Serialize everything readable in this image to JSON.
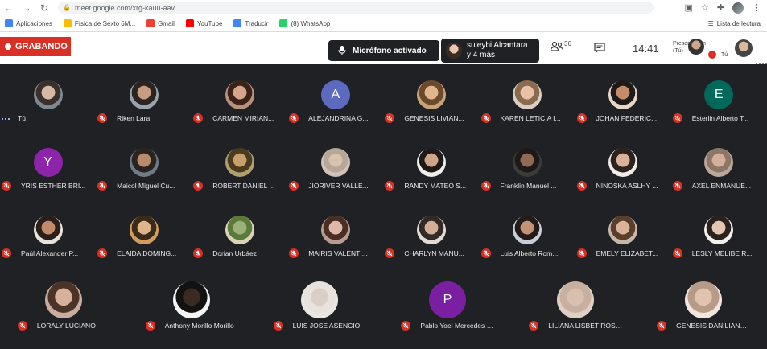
{
  "browser": {
    "url": "meet.google.com/xrg-kauu-aav",
    "bookmarks": [
      {
        "label": "Aplicaciones",
        "icon": "apps-grid-icon",
        "color": "#4285f4"
      },
      {
        "label": "Física de Sexto 6M...",
        "icon": "bookmark-page-icon",
        "color": "#fbbc04"
      },
      {
        "label": "Gmail",
        "icon": "gmail-icon",
        "color": "#ea4335"
      },
      {
        "label": "YouTube",
        "icon": "youtube-icon",
        "color": "#ff0000"
      },
      {
        "label": "Traducir",
        "icon": "translate-icon",
        "color": "#4285f4"
      },
      {
        "label": "(8) WhatsApp",
        "icon": "whatsapp-icon",
        "color": "#25d366"
      }
    ],
    "reading_list": "Lista de lectura"
  },
  "meet": {
    "recording_label": "GRABANDO",
    "mic_status": "Micrófono activado",
    "speaker_line1": "suleybi Alcantara",
    "speaker_line2": "y 4 más",
    "people_count": "36",
    "clock": "14:41",
    "presenter_label_1": "Presentación",
    "presenter_label_2": "(Tú)",
    "presenter_tu": "Tú",
    "accent": "#d93025"
  },
  "participants": [
    {
      "name": "Tú",
      "type": "photo",
      "skin": "#d5b9a5",
      "hair": "#3b2f2a",
      "bg": "#7d8891",
      "self": true
    },
    {
      "name": "Riken Lara",
      "type": "photo",
      "skin": "#c99b80",
      "hair": "#2b2522",
      "bg": "#9aa4ad"
    },
    {
      "name": "CARMEN MIRIAN...",
      "type": "photo",
      "skin": "#d7a58d",
      "hair": "#3a2418",
      "bg": "#b98f7e"
    },
    {
      "name": "ALEJANDRINA G...",
      "type": "letter",
      "letter": "A",
      "bg": "#5c6bc0"
    },
    {
      "name": "GENESIS LIVIAN...",
      "type": "photo",
      "skin": "#e0b590",
      "hair": "#6b4a2b",
      "bg": "#c7a37a"
    },
    {
      "name": "KAREN LETICIA I...",
      "type": "photo",
      "skin": "#e8c2a8",
      "hair": "#8b6b4e",
      "bg": "#d9cfc6"
    },
    {
      "name": "JOHAN FEDERIC...",
      "type": "photo",
      "skin": "#c48d68",
      "hair": "#1f1a17",
      "bg": "#e6d7c8"
    },
    {
      "name": "Esterlin Alberto T...",
      "type": "letter",
      "letter": "E",
      "bg": "#00695c"
    },
    {
      "name": "YRIS ESTHER BRI...",
      "type": "letter",
      "letter": "Y",
      "bg": "#8e24aa"
    },
    {
      "name": "Maicol Miguel Cu...",
      "type": "photo",
      "skin": "#b98a6d",
      "hair": "#2a2420",
      "bg": "#6f7b86"
    },
    {
      "name": "ROBERT DANIEL ...",
      "type": "photo",
      "skin": "#c7a06d",
      "hair": "#4a3a1e",
      "bg": "#b0a070"
    },
    {
      "name": "JIORIVER VALLE...",
      "type": "photo",
      "skin": "#d9c2b0",
      "hair": "#b8a696",
      "bg": "#cfc3b8"
    },
    {
      "name": "RANDY MATEO S...",
      "type": "photo",
      "skin": "#d0a58a",
      "hair": "#1d1a18",
      "bg": "#f0eeea"
    },
    {
      "name": "Franklin Manuel ...",
      "type": "photo",
      "skin": "#8f6a55",
      "hair": "#1c1917",
      "bg": "#3b3b3b"
    },
    {
      "name": "NINOSKA ASLHY ...",
      "type": "photo",
      "skin": "#d8b39a",
      "hair": "#2c231f",
      "bg": "#f1ece8"
    },
    {
      "name": "AXEL ENMANUE...",
      "type": "photo",
      "skin": "#d2b09b",
      "hair": "#8d7666",
      "bg": "#b9a89b"
    },
    {
      "name": "Paúl Alexander P...",
      "type": "photo",
      "skin": "#c28a6a",
      "hair": "#2a1f1a",
      "bg": "#e8e2dc"
    },
    {
      "name": "ELAIDA DOMING...",
      "type": "photo",
      "skin": "#e0b48a",
      "hair": "#3a2a1a",
      "bg": "#d19c5c"
    },
    {
      "name": "Dorian Urbáez",
      "type": "photo",
      "skin": "#9bb07a",
      "hair": "#5b7a3a",
      "bg": "#dcd2b6"
    },
    {
      "name": "MAIRIS VALENTI...",
      "type": "photo",
      "skin": "#e0b8a8",
      "hair": "#4a2e24",
      "bg": "#b89c91"
    },
    {
      "name": "CHARLYN MANU...",
      "type": "photo",
      "skin": "#d3ad98",
      "hair": "#322a26",
      "bg": "#e3dbd3"
    },
    {
      "name": "Luis Alberto Rom...",
      "type": "photo",
      "skin": "#c39274",
      "hair": "#211c19",
      "bg": "#c9cfd6"
    },
    {
      "name": "EMELY ELIZABET...",
      "type": "photo",
      "skin": "#d8b49a",
      "hair": "#5a3d2a",
      "bg": "#c7b8aa"
    },
    {
      "name": "LESLY MELIBE R...",
      "type": "photo",
      "skin": "#e6c6b0",
      "hair": "#2b2220",
      "bg": "#f3efec"
    },
    {
      "name": "LORALY LUCIANO",
      "type": "photo",
      "skin": "#d9b09a",
      "hair": "#4a3428",
      "bg": "#c8aca0"
    },
    {
      "name": "Anthony Morillo Morillo",
      "type": "photo",
      "skin": "#3a2a22",
      "hair": "#121212",
      "bg": "#f5f5f5"
    },
    {
      "name": "LUIS JOSE ASENCIO",
      "type": "photo",
      "skin": "#d9cfc6",
      "hair": "#e8e2dc",
      "bg": "#eae6e2"
    },
    {
      "name": "Pablo Yoel Mercedes Poché",
      "type": "letter",
      "letter": "P",
      "bg": "#7b1fa2"
    },
    {
      "name": "LILIANA LISBET ROSARIO",
      "type": "photo",
      "skin": "#d8c0b0",
      "hair": "#c8b0a0",
      "bg": "#e0d0c4"
    },
    {
      "name": "GENESIS DANILIANYI BRIT...",
      "type": "photo",
      "skin": "#e3c3ad",
      "hair": "#b89a88",
      "bg": "#f0e6de"
    }
  ]
}
